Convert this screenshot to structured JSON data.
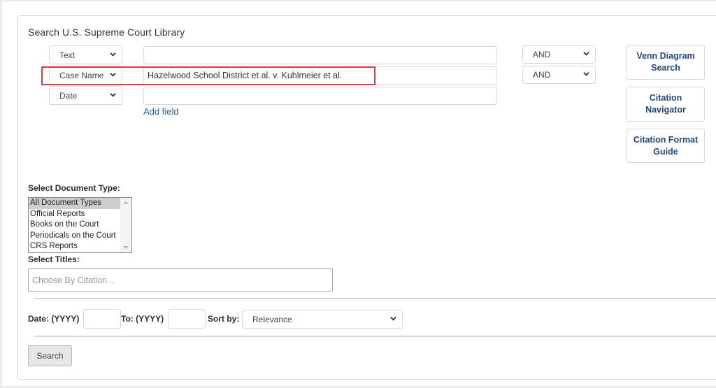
{
  "page": {
    "title": "Search U.S. Supreme Court Library"
  },
  "search_rows": [
    {
      "field": "Text",
      "value": "",
      "operator": "AND"
    },
    {
      "field": "Case Name",
      "value": "Hazelwood School District et al. v. Kuhlmeier et al.",
      "operator": "AND"
    },
    {
      "field": "Date",
      "value": ""
    }
  ],
  "add_field_label": "Add field",
  "side_buttons": {
    "venn": "Venn Diagram Search",
    "citation_navigator": "Citation Navigator",
    "citation_format": "Citation Format Guide"
  },
  "document_type": {
    "label": "Select Document Type:",
    "options": [
      "All Document Types",
      "Official Reports",
      "Books on the Court",
      "Periodicals on the Court",
      "CRS Reports"
    ],
    "selected": "All Document Types"
  },
  "titles": {
    "label": "Select Titles:",
    "placeholder": "Choose By Citation..."
  },
  "date_range": {
    "from_label": "Date: (YYYY)",
    "from_value": "",
    "to_label": "To: (YYYY)",
    "to_value": ""
  },
  "sort": {
    "label": "Sort by:",
    "value": "Relevance"
  },
  "search_button": "Search",
  "colors": {
    "highlight": "#e5393f",
    "link": "#2c5b8e",
    "button_text": "#244a7c"
  }
}
